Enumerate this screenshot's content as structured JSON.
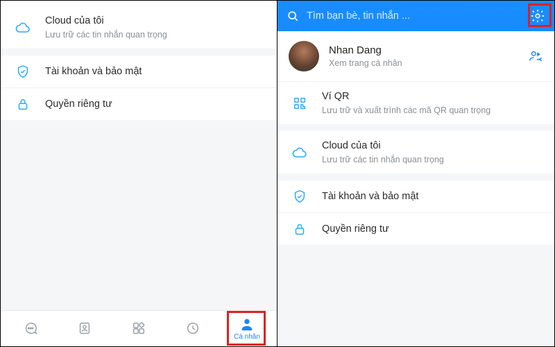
{
  "colors": {
    "accent": "#1b84ff",
    "muted": "#8b8f94",
    "highlight": "#e02020"
  },
  "left": {
    "cloud": {
      "title": "Cloud của tôi",
      "sub": "Lưu trữ các tin nhắn quan trọng"
    },
    "account": {
      "title": "Tài khoản và bảo mật"
    },
    "privacy": {
      "title": "Quyền riêng tư"
    },
    "nav": {
      "messages_label": "",
      "contacts_label": "",
      "more_label": "",
      "recent_label": "",
      "personal_label": "Cá nhân"
    }
  },
  "right": {
    "search_placeholder": "Tìm bạn bè, tin nhắn ...",
    "profile": {
      "name": "Nhan Dang",
      "sub": "Xem trang cá nhân"
    },
    "qr": {
      "title": "Ví QR",
      "sub": "Lưu trữ và xuất trình các mã QR quan trọng"
    },
    "cloud": {
      "title": "Cloud của tôi",
      "sub": "Lưu trữ các tin nhắn quan trọng"
    },
    "account": {
      "title": "Tài khoản và bảo mật"
    },
    "privacy": {
      "title": "Quyền riêng tư"
    }
  }
}
